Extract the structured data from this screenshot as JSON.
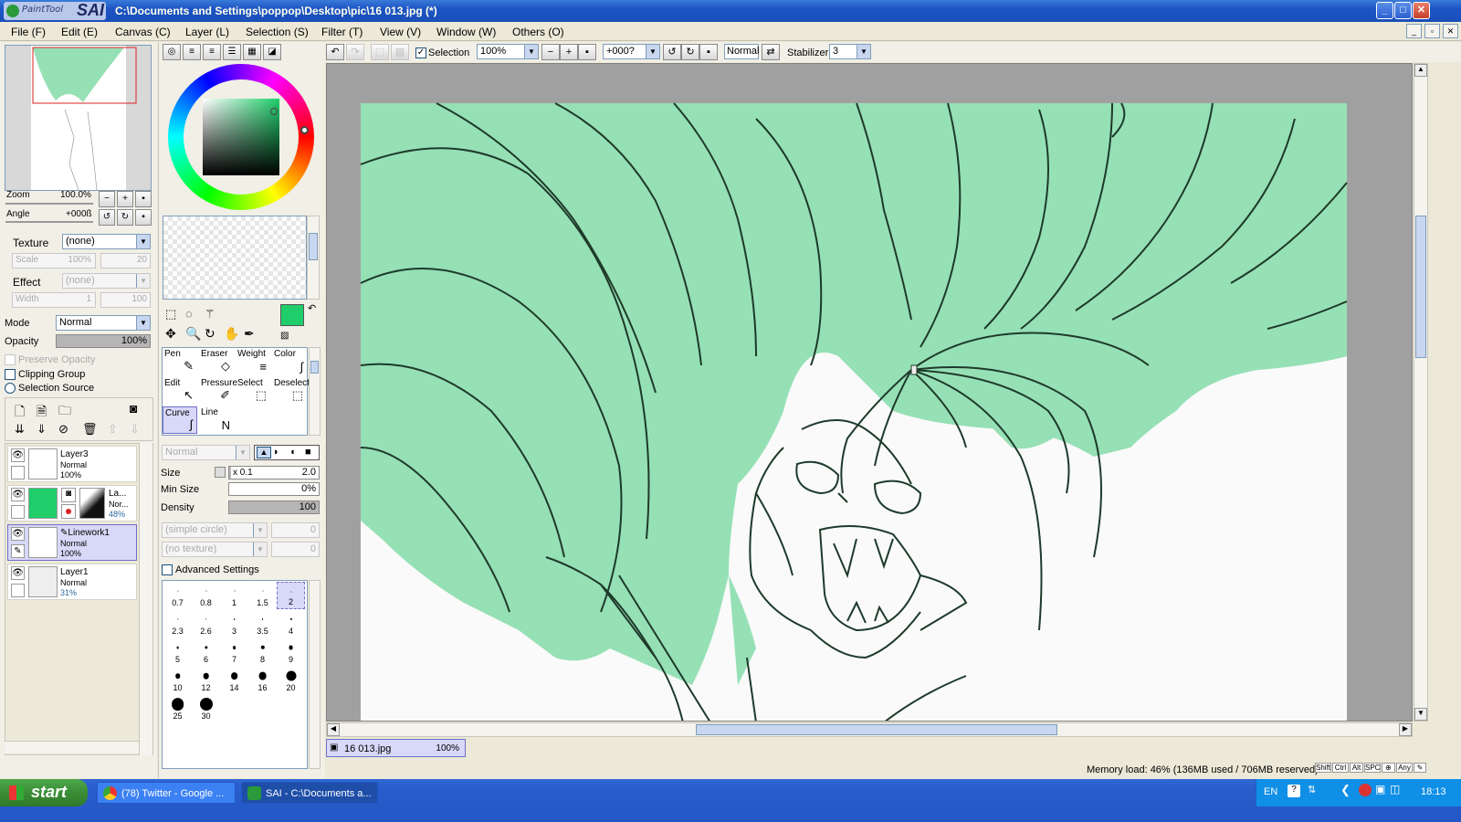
{
  "window": {
    "app_name": "PaintTool",
    "app_logo": "SAI",
    "title_path": "C:\\Documents and Settings\\poppop\\Desktop\\pic\\16 013.jpg (*)",
    "min_label": "_",
    "max_label": "□",
    "close_label": "✕"
  },
  "menu": [
    "File (F)",
    "Edit (E)",
    "Canvas (C)",
    "Layer (L)",
    "Selection (S)",
    "Filter (T)",
    "View (V)",
    "Window (W)",
    "Others (O)"
  ],
  "navigator": {
    "zoom_label": "Zoom",
    "zoom_value": "100.0%",
    "angle_label": "Angle",
    "angle_value": "+000ß"
  },
  "layer_props": {
    "texture_label": "Texture",
    "texture_value": "(none)",
    "scale_label": "Scale",
    "scale_value": "100%",
    "scale_amount": "20",
    "effect_label": "Effect",
    "effect_value": "(none)",
    "width_label": "Width",
    "width_value": "1",
    "width_amount": "100",
    "mode_label": "Mode",
    "mode_value": "Normal",
    "opacity_label": "Opacity",
    "opacity_value": "100%",
    "opacity_fraction": 1.0,
    "preserve_opacity": "Preserve Opacity",
    "clipping_group": "Clipping Group",
    "selection_source": "Selection Source"
  },
  "layers": [
    {
      "name": "Layer3",
      "mode": "Normal",
      "opacity": "100%"
    },
    {
      "name": "La...",
      "mode": "Nor...",
      "opacity": "48%"
    },
    {
      "name": "Linework1",
      "mode": "Normal",
      "opacity": "100%"
    },
    {
      "name": "Layer1",
      "mode": "Normal",
      "opacity": "31%"
    }
  ],
  "tools": [
    {
      "name": "Pen",
      "icon": "pen-icon",
      "glyph": "✎"
    },
    {
      "name": "Eraser",
      "icon": "eraser-icon",
      "glyph": "◇"
    },
    {
      "name": "Weight",
      "icon": "weight-icon",
      "glyph": "≡"
    },
    {
      "name": "Color",
      "icon": "color-icon",
      "glyph": "∫"
    },
    {
      "name": "Edit",
      "icon": "edit-icon",
      "glyph": "↖"
    },
    {
      "name": "Pressure",
      "icon": "pressure-icon",
      "glyph": "✐"
    },
    {
      "name": "Select",
      "icon": "select-icon",
      "glyph": "⬚"
    },
    {
      "name": "Deselect",
      "icon": "deselect-icon",
      "glyph": "⬚"
    },
    {
      "name": "Curve",
      "icon": "curve-icon",
      "glyph": "∫"
    },
    {
      "name": "Line",
      "icon": "line-icon",
      "glyph": "N"
    }
  ],
  "brush": {
    "blend_mode": "Normal",
    "size_label": "Size",
    "size_multiplier": "x 0.1",
    "size_value": "2.0",
    "min_size_label": "Min Size",
    "min_size_value": "0%",
    "min_size_fraction": 0.0,
    "density_label": "Density",
    "density_value": "100",
    "density_fraction": 1.0,
    "shape": "(simple circle)",
    "shape_amount": "0",
    "texture": "(no texture)",
    "texture_amount": "0",
    "advanced_settings": "Advanced Settings",
    "sizes": [
      "0.7",
      "0.8",
      "1",
      "1.5",
      "2",
      "2.3",
      "2.6",
      "3",
      "3.5",
      "4",
      "5",
      "6",
      "7",
      "8",
      "9",
      "10",
      "12",
      "14",
      "16",
      "20",
      "25",
      "30"
    ],
    "selected_size": "2"
  },
  "toolbar": {
    "selection_label": "Selection",
    "zoom_value": "100%",
    "angle_value": "+000?",
    "mode_value": "Normal",
    "stabilizer_label": "Stabilizer",
    "stabilizer_value": "3"
  },
  "colors": {
    "main_color": "#1fce6a",
    "hair_color": "#96e0b6",
    "line_color": "#1e3a2a"
  },
  "document_tab": {
    "name": "16 013.jpg",
    "zoom": "100%"
  },
  "status": {
    "memory": "Memory load: 46% (136MB used / 706MB reserved)",
    "keys": [
      "Shift",
      "Ctrl",
      "Alt",
      "SPC",
      "Any"
    ]
  },
  "taskbar": {
    "start": "start",
    "items": [
      "(78) Twitter - Google ...",
      "SAI - C:\\Documents a..."
    ],
    "lang": "EN",
    "time": "18:13"
  }
}
